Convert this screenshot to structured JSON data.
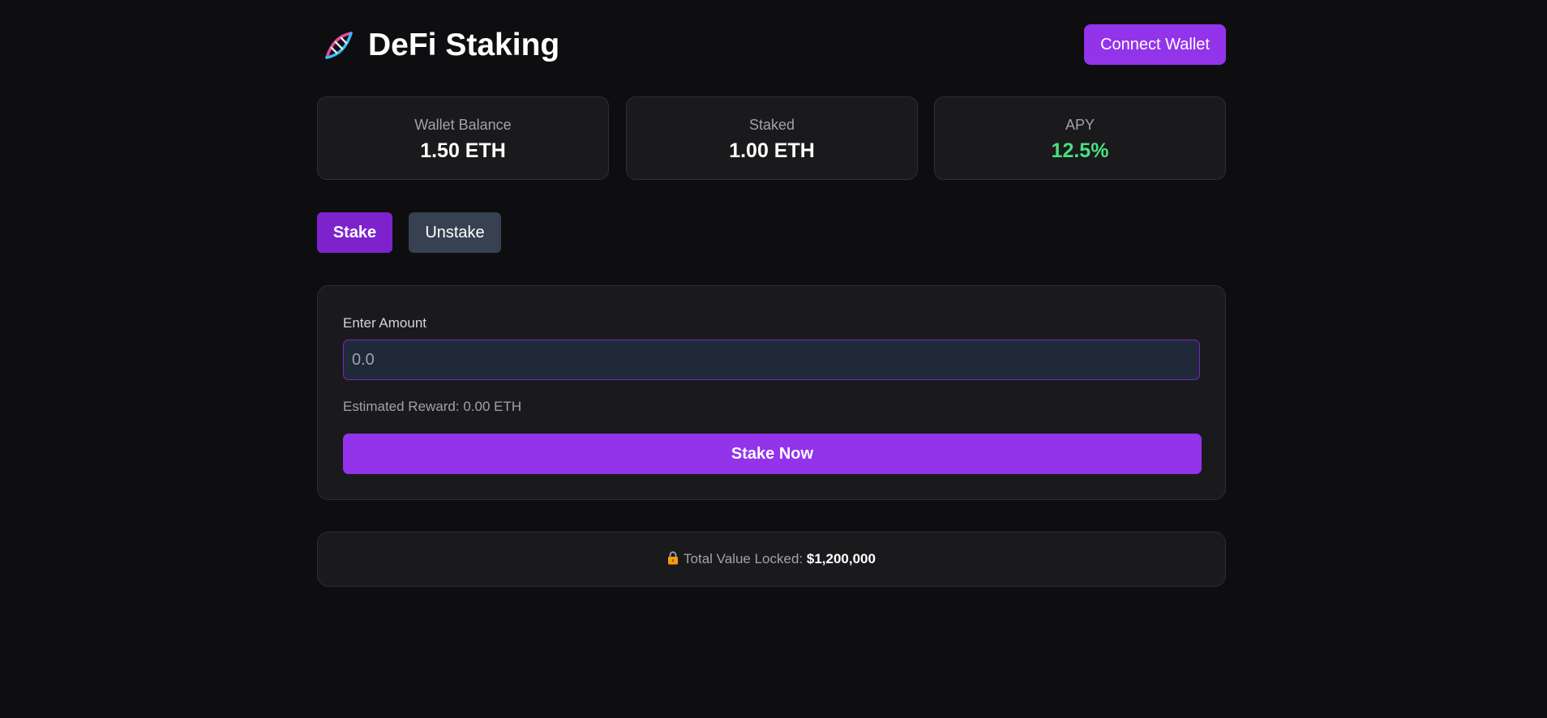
{
  "header": {
    "logo_icon": "dna-icon",
    "title": "DeFi Staking",
    "connect_label": "Connect Wallet"
  },
  "stats": [
    {
      "label": "Wallet Balance",
      "value": "1.50 ETH"
    },
    {
      "label": "Staked",
      "value": "1.00 ETH"
    },
    {
      "label": "APY",
      "value": "12.5%"
    }
  ],
  "tabs": {
    "stake_label": "Stake",
    "unstake_label": "Unstake",
    "active": "Stake"
  },
  "form": {
    "amount_label": "Enter Amount",
    "amount_value": "",
    "amount_placeholder": "0.0",
    "reward_text": "Estimated Reward: 0.00 ETH",
    "submit_label": "Stake Now"
  },
  "tvl": {
    "icon": "lock-icon",
    "label": "Total Value Locked: ",
    "value": "$1,200,000"
  },
  "colors": {
    "background": "#0e0e11",
    "card": "#1a1a1d",
    "accent": "#9333ea",
    "accent_dark": "#7e22ce",
    "inactive_tab": "#374151",
    "input_bg": "#1f2937",
    "positive": "#4ade80"
  }
}
